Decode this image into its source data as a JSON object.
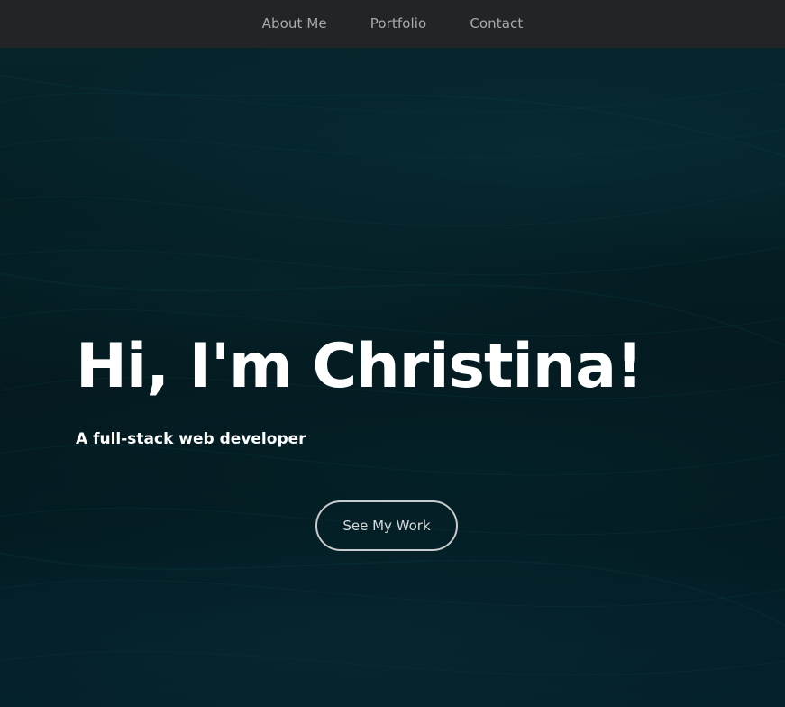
{
  "nav": {
    "items": [
      {
        "label": "About Me"
      },
      {
        "label": "Portfolio"
      },
      {
        "label": "Contact"
      }
    ]
  },
  "hero": {
    "title": "Hi, I'm Christina!",
    "subtitle": "A full-stack web developer",
    "cta_label": "See My Work"
  },
  "colors": {
    "navbar_bg": "#222428",
    "nav_text": "#a8aaad",
    "hero_bg": "#041b21",
    "hero_text": "#ffffff",
    "button_border": "#c9cbcc"
  }
}
